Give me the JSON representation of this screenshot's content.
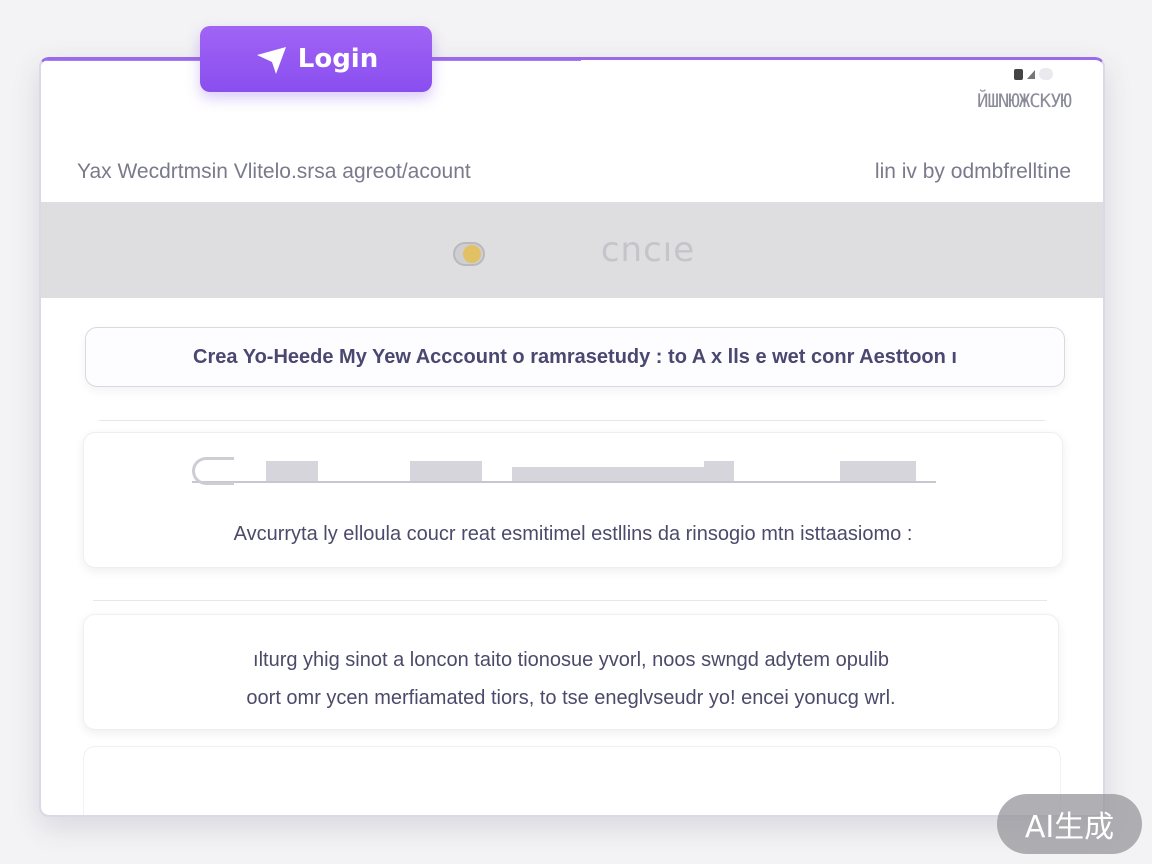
{
  "login": {
    "label": "Login",
    "icon": "cursor-arrow-icon"
  },
  "status": {
    "code": "ЙШNЮЖCКУЮ"
  },
  "header": {
    "left": "Yax Wecdrtmsin Vlitelo.srsa agreot/acount",
    "right": "lin iv by odmbfrelltine"
  },
  "banner": {
    "icon": "lock-icon",
    "label": "cncıe"
  },
  "create_account": {
    "label": "Crea Yo-Heede My Yew Acccount o ramrasetudy : to A x lls e wet conr Aesttoon ı"
  },
  "security": {
    "icon": "key-icon",
    "text": "Avcurryta ly elloula coucr reat esmitimel estllins da rinsogio mtn isttaasiomo :"
  },
  "info": {
    "line1": "ılturg yhig sinot a loncon taito tionosue yvorl, noos swngd adytem opulib",
    "line2": "oort omr ycen merfiamated tiors, to tse eneglvseudr yo! encei yonucg wrl."
  },
  "badge": {
    "label": "AI生成"
  },
  "colors": {
    "accent": "#9b5ef3",
    "banner": "#dedee0",
    "text": "#4c4a6a"
  }
}
